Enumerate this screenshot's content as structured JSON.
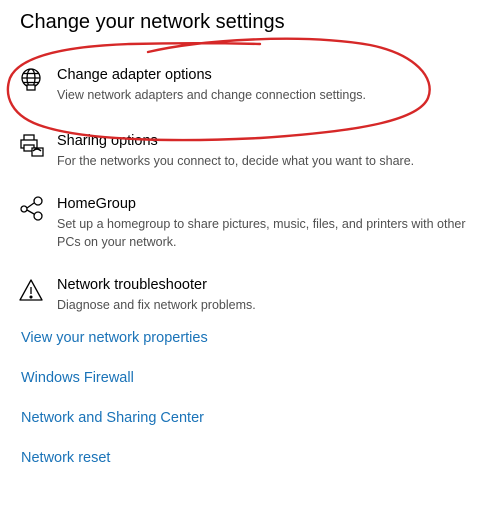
{
  "page": {
    "title": "Change your network settings"
  },
  "items": [
    {
      "icon": "globe-adapter-icon",
      "name": "Change adapter options",
      "description": "View network adapters and change connection settings."
    },
    {
      "icon": "sharing-icon",
      "name": "Sharing options",
      "description": "For the networks you connect to, decide what you want to share."
    },
    {
      "icon": "homegroup-icon",
      "name": "HomeGroup",
      "description": "Set up a homegroup to share pictures, music, files, and printers with other PCs on your network."
    },
    {
      "icon": "warning-triangle-icon",
      "name": "Network troubleshooter",
      "description": "Diagnose and fix network problems."
    }
  ],
  "links": [
    "View your network properties",
    "Windows Firewall",
    "Network and Sharing Center",
    "Network reset"
  ],
  "colors": {
    "link": "#1a73b8",
    "description": "#505050",
    "annotation": "#d62828"
  }
}
